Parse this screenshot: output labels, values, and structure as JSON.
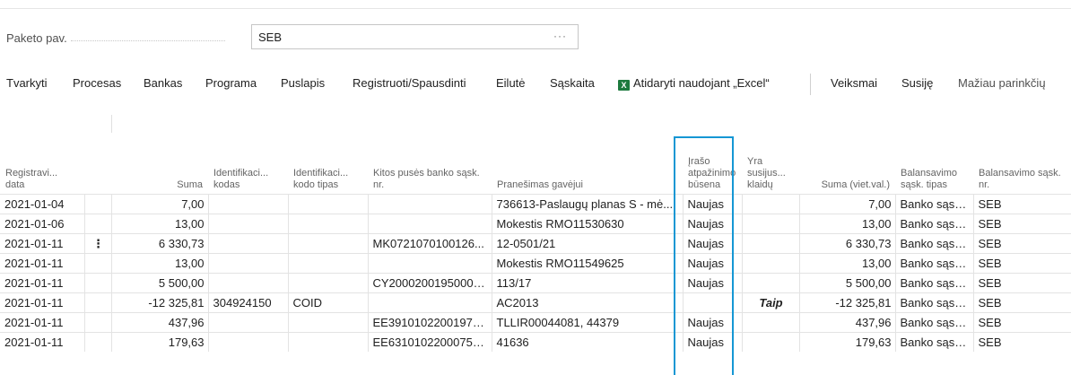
{
  "header": {
    "field_label": "Paketo pav.",
    "field_value": "SEB",
    "field_more": "···"
  },
  "actions": {
    "items": [
      "Tvarkyti",
      "Procesas",
      "Bankas",
      "Programa",
      "Puslapis",
      "Registruoti/Spausdinti",
      "Eilutė",
      "Sąskaita"
    ],
    "excel_label": "Atidaryti naudojant „Excel“",
    "excel_icon": "excel-icon",
    "right_items": [
      "Veiksmai",
      "Susiję"
    ],
    "fewer_options": "Mažiau parinkčių"
  },
  "table": {
    "columns": [
      "Registravi... data",
      "",
      "Suma",
      "Identifikaci... kodas",
      "Identifikaci... kodo tipas",
      "Kitos pusės banko sąsk. nr.",
      "Pranešimas gavėjui",
      "Įrašo atpažinimo būsena",
      "Yra susijus... klaidų",
      "Suma (viet.val.)",
      "Balansavimo sąsk. tipas",
      "Balansavimo sąsk. nr."
    ],
    "rows": [
      [
        "2021-01-04",
        "",
        "7,00",
        "",
        "",
        "",
        "736613-Paslaugų planas S - mė...",
        "Naujas",
        "",
        "7,00",
        "Banko sąsk...",
        "SEB"
      ],
      [
        "2021-01-06",
        "",
        "13,00",
        "",
        "",
        "",
        "Mokestis RMO11530630",
        "Naujas",
        "",
        "13,00",
        "Banko sąsk...",
        "SEB"
      ],
      [
        "2021-01-11",
        "⋮",
        "6 330,73",
        "",
        "",
        "MK0721070100126...",
        "12-0501/21",
        "Naujas",
        "",
        "6 330,73",
        "Banko sąsk...",
        "SEB"
      ],
      [
        "2021-01-11",
        "",
        "13,00",
        "",
        "",
        "",
        "Mokestis RMO11549625",
        "Naujas",
        "",
        "13,00",
        "Banko sąsk...",
        "SEB"
      ],
      [
        "2021-01-11",
        "",
        "5 500,00",
        "",
        "",
        "CY20002001950000...",
        "113/17",
        "Naujas",
        "",
        "5 500,00",
        "Banko sąsk...",
        "SEB"
      ],
      [
        "2021-01-11",
        "",
        "-12 325,81",
        "304924150",
        "COID",
        "",
        "AC2013",
        "",
        "Taip",
        "-12 325,81",
        "Banko sąsk...",
        "SEB"
      ],
      [
        "2021-01-11",
        "",
        "437,96",
        "",
        "",
        "EE39101022001973...",
        "TLLIR00044081, 44379",
        "Naujas",
        "",
        "437,96",
        "Banko sąsk...",
        "SEB"
      ],
      [
        "2021-01-11",
        "",
        "179,63",
        "",
        "",
        "EE63101022000757...",
        "41636",
        "Naujas",
        "",
        "179,63",
        "Banko sąsk...",
        "SEB"
      ]
    ]
  },
  "colors": {
    "highlight": "#1597d4",
    "error": "#b00c0c",
    "excel": "#1d7a3e"
  }
}
